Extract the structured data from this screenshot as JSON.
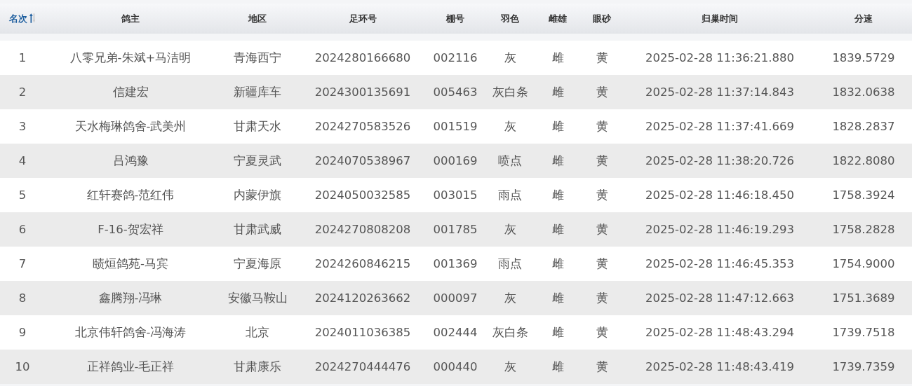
{
  "table": {
    "columns": [
      {
        "label": "名次",
        "sorted": true
      },
      {
        "label": "鸽主",
        "sorted": false
      },
      {
        "label": "地区",
        "sorted": false
      },
      {
        "label": "足环号",
        "sorted": false
      },
      {
        "label": "棚号",
        "sorted": false
      },
      {
        "label": "羽色",
        "sorted": false
      },
      {
        "label": "雌雄",
        "sorted": false
      },
      {
        "label": "眼砂",
        "sorted": false
      },
      {
        "label": "归巢时间",
        "sorted": false
      },
      {
        "label": "分速",
        "sorted": false
      }
    ],
    "rows": [
      [
        "1",
        "八零兄弟-朱斌+马洁明",
        "青海西宁",
        "2024280166680",
        "002116",
        "灰",
        "雌",
        "黄",
        "2025-02-28 11:36:21.880",
        "1839.5729"
      ],
      [
        "2",
        "信建宏",
        "新疆库车",
        "2024300135691",
        "005463",
        "灰白条",
        "雌",
        "黄",
        "2025-02-28 11:37:14.843",
        "1832.0638"
      ],
      [
        "3",
        "天水梅琳鸽舍-武美州",
        "甘肃天水",
        "2024270583526",
        "001519",
        "灰",
        "雌",
        "黄",
        "2025-02-28 11:37:41.669",
        "1828.2837"
      ],
      [
        "4",
        "吕鸿豫",
        "宁夏灵武",
        "2024070538967",
        "000169",
        "喷点",
        "雌",
        "黄",
        "2025-02-28 11:38:20.726",
        "1822.8080"
      ],
      [
        "5",
        "红轩赛鸽-范红伟",
        "内蒙伊旗",
        "2024050032585",
        "003015",
        "雨点",
        "雌",
        "黄",
        "2025-02-28 11:46:18.450",
        "1758.3924"
      ],
      [
        "6",
        "F-16-贺宏祥",
        "甘肃武威",
        "2024270808208",
        "001785",
        "灰",
        "雌",
        "黄",
        "2025-02-28 11:46:19.293",
        "1758.2828"
      ],
      [
        "7",
        "赜烜鸽苑-马宾",
        "宁夏海原",
        "2024260846215",
        "001369",
        "雨点",
        "雌",
        "黄",
        "2025-02-28 11:46:45.353",
        "1754.9000"
      ],
      [
        "8",
        "鑫腾翔-冯琳",
        "安徽马鞍山",
        "2024120263662",
        "000097",
        "灰",
        "雌",
        "黄",
        "2025-02-28 11:47:12.663",
        "1751.3689"
      ],
      [
        "9",
        "北京伟轩鸽舍-冯海涛",
        "北京",
        "2024011036385",
        "002444",
        "灰白条",
        "雌",
        "黄",
        "2025-02-28 11:48:43.294",
        "1739.7518"
      ],
      [
        "10",
        "正祥鸽业-毛正祥",
        "甘肃康乐",
        "2024270444476",
        "000440",
        "灰",
        "雌",
        "黄",
        "2025-02-28 11:48:43.419",
        "1739.7359"
      ]
    ]
  }
}
